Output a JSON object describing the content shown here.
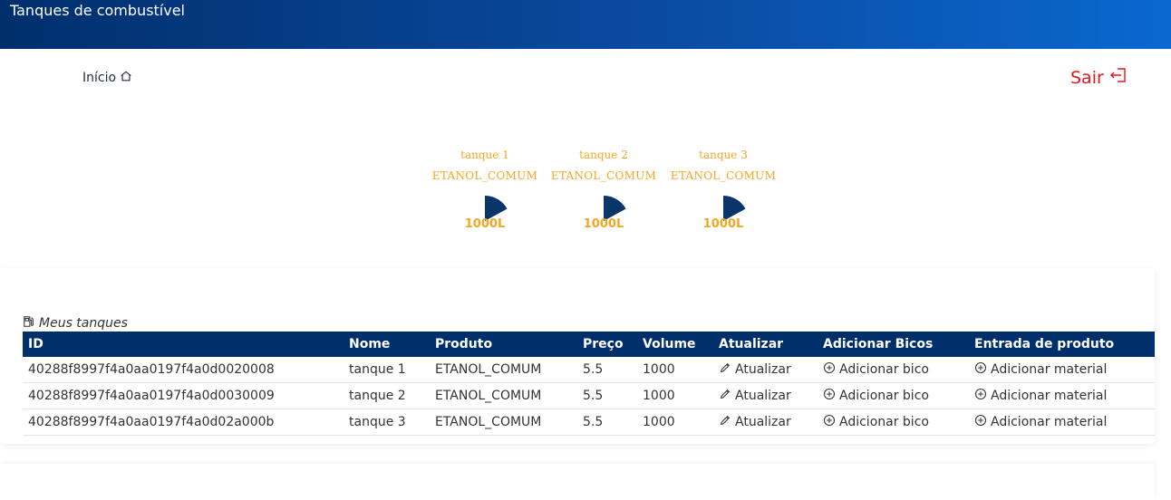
{
  "header": {
    "title": "Tanques de combustível"
  },
  "nav": {
    "home_label": "Início",
    "logout_label": "Sair"
  },
  "tanks": [
    {
      "name": "tanque 1",
      "product": "ETANOL_COMUM",
      "volume_label": "1000L",
      "fill_fraction": 0.17
    },
    {
      "name": "tanque 2",
      "product": "ETANOL_COMUM",
      "volume_label": "1000L",
      "fill_fraction": 0.17
    },
    {
      "name": "tanque 3",
      "product": "ETANOL_COMUM",
      "volume_label": "1000L",
      "fill_fraction": 0.17
    }
  ],
  "colors": {
    "gauge": "#0a3568",
    "accent": "#f5a623",
    "header_dark": "#002f6c",
    "logout": "#e01818"
  },
  "table": {
    "caption": "Meus tanques",
    "headers": [
      "ID",
      "Nome",
      "Produto",
      "Preço",
      "Volume",
      "Atualizar",
      "Adicionar Bicos",
      "Entrada de produto"
    ],
    "rows": [
      {
        "id": "40288f8997f4a0aa0197f4a0d0020008",
        "name": "tanque 1",
        "product": "ETANOL_COMUM",
        "price": "5.5",
        "volume": "1000",
        "update": "Atualizar",
        "add_nozzle": "Adicionar bico",
        "add_material": "Adicionar material"
      },
      {
        "id": "40288f8997f4a0aa0197f4a0d0030009",
        "name": "tanque 2",
        "product": "ETANOL_COMUM",
        "price": "5.5",
        "volume": "1000",
        "update": "Atualizar",
        "add_nozzle": "Adicionar bico",
        "add_material": "Adicionar material"
      },
      {
        "id": "40288f8997f4a0aa0197f4a0d02a000b",
        "name": "tanque 3",
        "product": "ETANOL_COMUM",
        "price": "5.5",
        "volume": "1000",
        "update": "Atualizar",
        "add_nozzle": "Adicionar bico",
        "add_material": "Adicionar material"
      }
    ]
  }
}
